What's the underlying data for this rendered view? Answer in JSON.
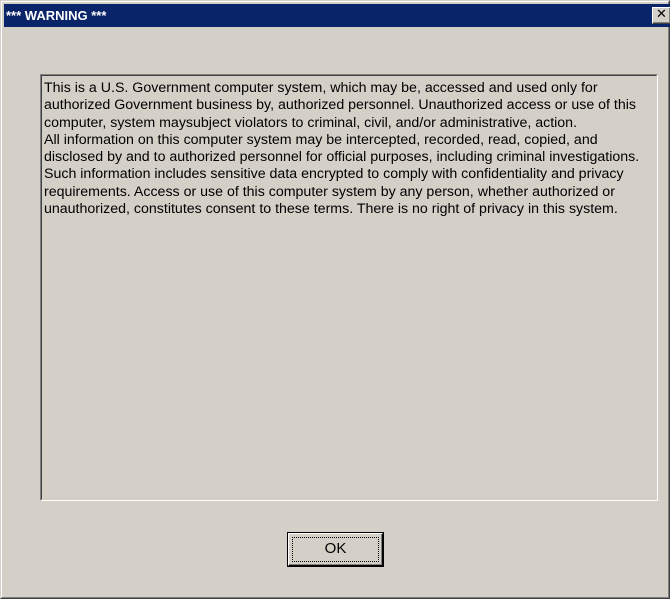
{
  "window": {
    "title": "*** WARNING ***",
    "close_glyph": "✕"
  },
  "message": {
    "paragraph_1": "This is a U.S. Government computer system, which may be, accessed and used only for authorized Government business by, authorized personnel.  Unauthorized access or use of this computer, system maysubject violators to criminal, civil, and/or administrative, action.",
    "paragraph_2": "All information on this computer system may be intercepted, recorded, read, copied, and disclosed by and to authorized personnel for official purposes, including criminal investigations. Such information includes sensitive data encrypted to comply with confidentiality and privacy requirements. Access or use of this computer system by any person, whether authorized or unauthorized, constitutes consent to these terms. There is no right of privacy in this system."
  },
  "buttons": {
    "ok_label": "OK"
  },
  "colors": {
    "titlebar": "#0a246a",
    "dialog_face": "#d4d0c8"
  },
  "icons": {
    "close": "close-icon"
  }
}
